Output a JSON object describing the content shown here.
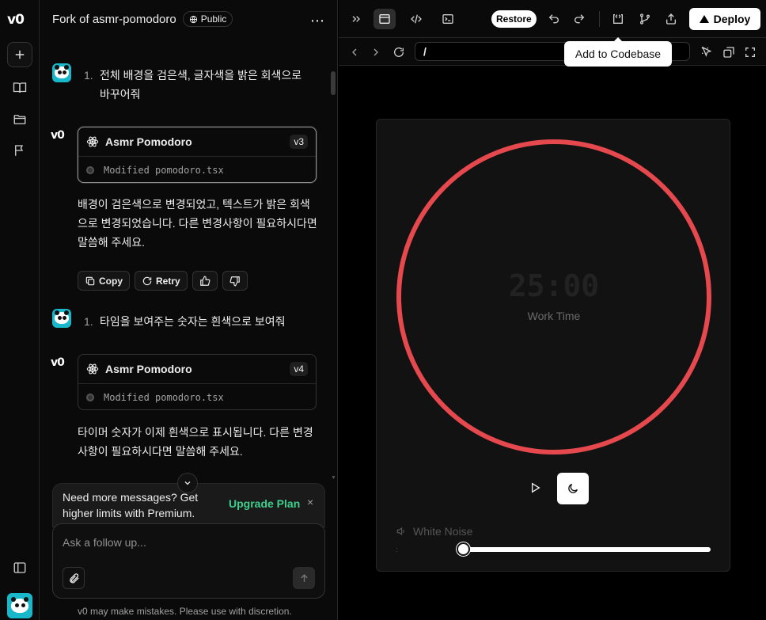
{
  "rail": {
    "logo": "v0",
    "items": [
      "new-chat",
      "library",
      "projects",
      "feedback"
    ]
  },
  "chat": {
    "title": "Fork of asmr-pomodoro",
    "visibility": "Public",
    "messages": [
      {
        "role": "user",
        "number": "1.",
        "text": "전체 배경을 검은색, 글자색을 밝은 회색으로 바꾸어줘"
      },
      {
        "role": "assistant",
        "card_title": "Asmr Pomodoro",
        "version": "v3",
        "file_note": "Modified pomodoro.tsx",
        "text": "배경이 검은색으로 변경되었고, 텍스트가 밝은 회색으로 변경되었습니다. 다른 변경사항이 필요하시다면 말씀해 주세요."
      },
      {
        "role": "user",
        "number": "1.",
        "text": "타임을 보여주는 숫자는 흰색으로 보여줘"
      },
      {
        "role": "assistant",
        "card_title": "Asmr Pomodoro",
        "version": "v4",
        "file_note": "Modified pomodoro.tsx",
        "text": "타이머 숫자가 이제 흰색으로 표시됩니다. 다른 변경사항이 필요하시다면 말씀해 주세요."
      }
    ],
    "actions": {
      "copy": "Copy",
      "retry": "Retry"
    },
    "upgrade": {
      "text": "Need more messages? Get higher limits with Premium.",
      "link": "Upgrade Plan",
      "close": "×"
    },
    "composer": {
      "placeholder": "Ask a follow up..."
    },
    "disclaimer": "v0 may make mistakes. Please use with discretion."
  },
  "toolbar": {
    "restore": "Restore",
    "deploy": "Deploy",
    "tooltip": "Add to Codebase"
  },
  "urlbar": {
    "path": "/"
  },
  "app": {
    "timer": "25:00",
    "mode": "Work Time",
    "white_noise_label": "White Noise",
    "volume": 0.0,
    "accent_color": "#e5484d"
  }
}
